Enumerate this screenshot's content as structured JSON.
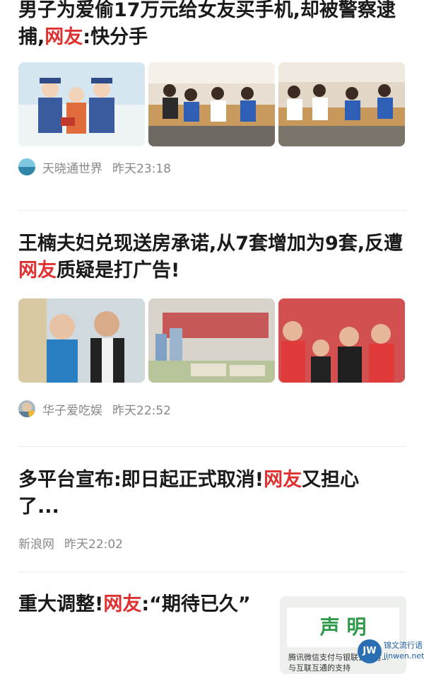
{
  "feed": [
    {
      "title_parts": [
        "男子为爱偷17万元给女友买手机,却被警察逮捕,",
        "网友",
        ":快分手"
      ],
      "source": "天晓通世界",
      "time": "昨天23:18"
    },
    {
      "title_parts": [
        "王楠夫妇兑现送房承诺,从7套增加为9套,反遭",
        "网友",
        "质疑是打广告!"
      ],
      "source": "华子爱吃娱",
      "time": "昨天22:52"
    },
    {
      "title_parts": [
        "多平台宣布:即日起正式取消!",
        "网友",
        "又担心了..."
      ],
      "source": "新浪网",
      "time": "昨天22:02"
    },
    {
      "title_parts": [
        "重大调整!",
        "网友",
        ":“期待已久”"
      ],
      "thumb_heading": "声 明",
      "thumb_text": "腾讯微信支付与银联云闪付...",
      "thumb_text2": "与互联互通的支持"
    }
  ],
  "stamp": {
    "id_label": "JW",
    "text1": "锦文流行语",
    "text2": "jinwen.net"
  },
  "colors": {
    "highlight": "#e03131",
    "meta": "#888888"
  }
}
